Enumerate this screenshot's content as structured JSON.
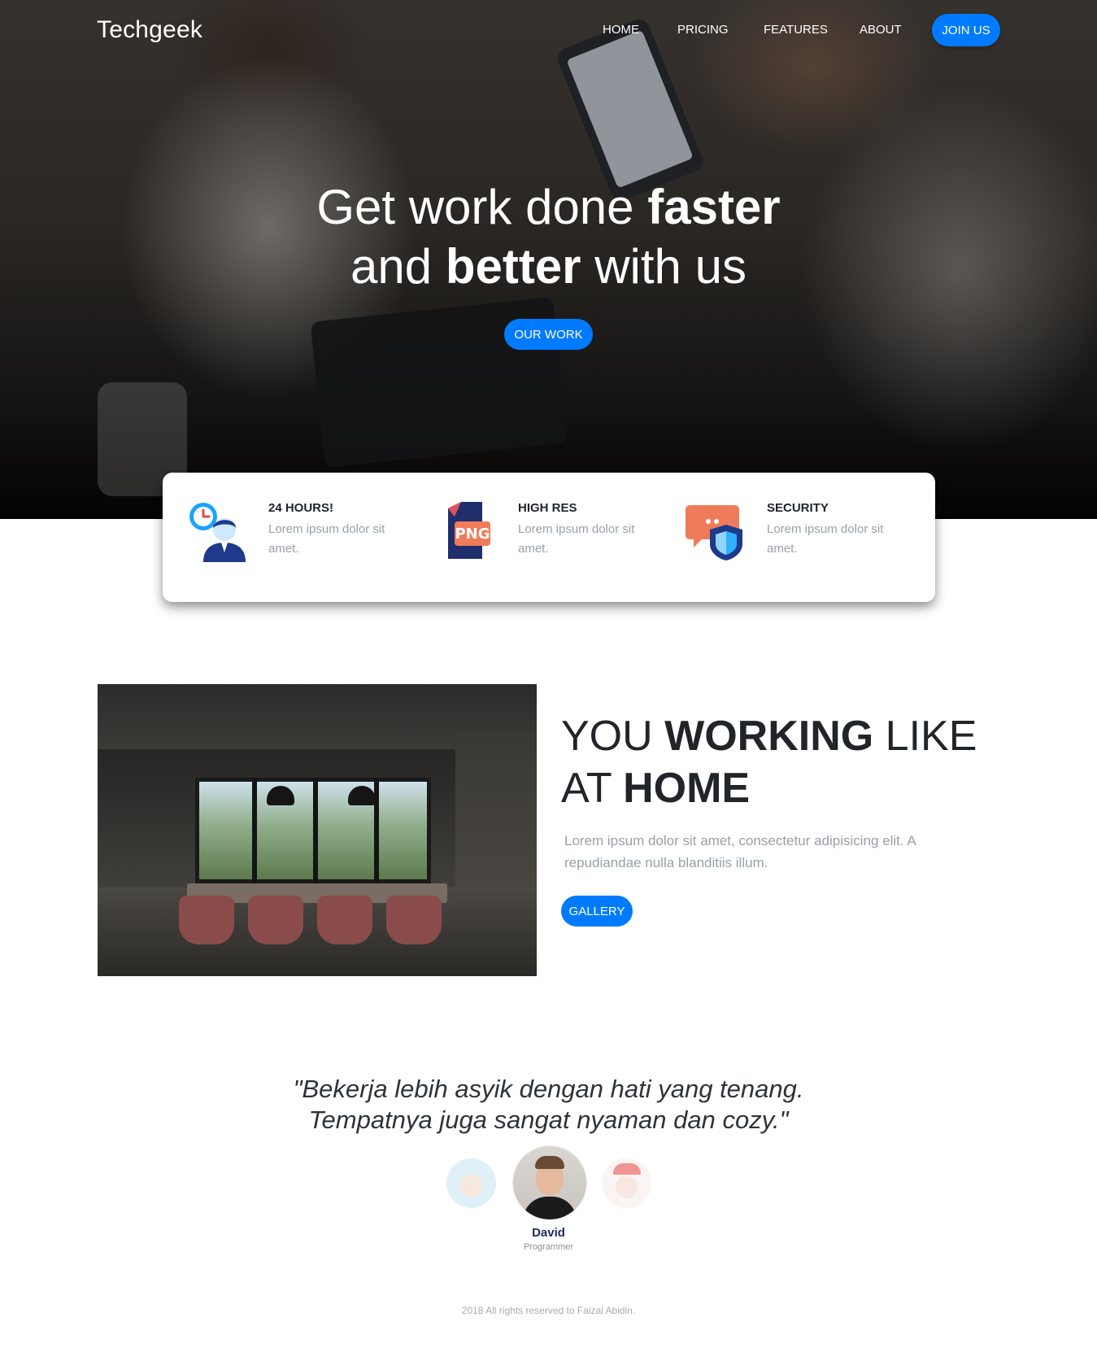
{
  "brand": "Techgeek",
  "nav": {
    "items": [
      {
        "label": "HOME"
      },
      {
        "label": "PRICING"
      },
      {
        "label": "FEATURES"
      },
      {
        "label": "ABOUT"
      }
    ],
    "join_label": "JOIN US"
  },
  "hero": {
    "line1_pre": "Get work done ",
    "line1_bold": "faster",
    "line2_pre": "and ",
    "line2_bold": "better",
    "line2_post": " with us",
    "button_label": "OUR WORK"
  },
  "info": [
    {
      "icon": "clock-person-icon",
      "title": "24 HOURS!",
      "desc": "Lorem ipsum dolor sit amet."
    },
    {
      "icon": "png-file-icon",
      "title": "HIGH RES",
      "desc": "Lorem ipsum dolor sit amet."
    },
    {
      "icon": "chat-shield-icon",
      "title": "SECURITY",
      "desc": "Lorem ipsum dolor sit amet."
    }
  ],
  "png_badge": "PNG",
  "working": {
    "t1_pre": "YOU ",
    "t1_bold": "WORKING",
    "t1_post": " LIKE",
    "t2_pre": "AT ",
    "t2_bold": "HOME",
    "desc": "Lorem ipsum dolor sit amet, consectetur adipisicing elit. A repudiandae nulla blanditiis illum.",
    "button_label": "GALLERY"
  },
  "testimonial": {
    "quote_line1": "\"Bekerja lebih asyik dengan hati yang tenang.",
    "quote_line2": "Tempatnya juga sangat nyaman dan cozy.\"",
    "name": "David",
    "role": "Programmer"
  },
  "footer": "2018 All rights reserved to Faizal Abidin.",
  "colors": {
    "primary": "#007bff",
    "name": "#1f2b5b",
    "muted": "#9aa0a6"
  }
}
